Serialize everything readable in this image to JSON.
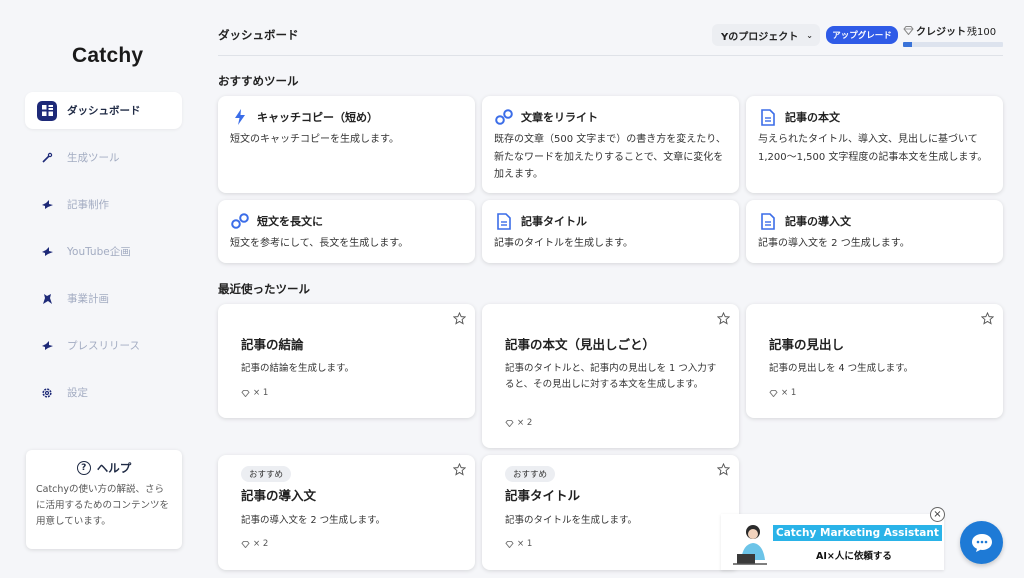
{
  "app": {
    "logo": "Catchy"
  },
  "sidebar": {
    "items": [
      {
        "label": "ダッシュボード",
        "icon": "dashboard-icon",
        "active": true
      },
      {
        "label": "生成ツール",
        "icon": "magic-wand-icon"
      },
      {
        "label": "記事制作",
        "icon": "bird-icon"
      },
      {
        "label": "YouTube企画",
        "icon": "bird-icon"
      },
      {
        "label": "事業計画",
        "icon": "unicorn-icon"
      },
      {
        "label": "プレスリリース",
        "icon": "bird-icon"
      },
      {
        "label": "設定",
        "icon": "gear-icon"
      }
    ],
    "help": {
      "title": "ヘルプ",
      "text": "Catchyの使い方の解説、さらに活用するためのコンテンツを用意しています。"
    }
  },
  "header": {
    "title": "ダッシュボード",
    "project": "Yのプロジェクト",
    "upgrade": "アップグレード",
    "credit_label": "クレジット",
    "credit_rest": "残100",
    "credit_fraction": 0.09,
    "accent": "#2f5be7"
  },
  "recommended": {
    "title": "おすすめツール",
    "cards": [
      {
        "title": "キャッチコピー（短め）",
        "desc": "短文のキャッチコピーを生成します。",
        "icon": "lightning-icon"
      },
      {
        "title": "文章をリライト",
        "desc": "既存の文章（500 文字まで）の書き方を変えたり、新たなワードを加えたりすることで、文章に変化を加えます。",
        "icon": "bubbles-icon"
      },
      {
        "title": "記事の本文",
        "desc": "与えられたタイトル、導入文、見出しに基づいて 1,200〜1,500 文字程度の記事本文を生成します。",
        "icon": "document-icon"
      },
      {
        "title": "短文を長文に",
        "desc": "短文を参考にして、長文を生成します。",
        "icon": "bubbles-icon"
      },
      {
        "title": "記事タイトル",
        "desc": "記事のタイトルを生成します。",
        "icon": "document-icon"
      },
      {
        "title": "記事の導入文",
        "desc": "記事の導入文を 2 つ生成します。",
        "icon": "document-icon"
      }
    ]
  },
  "recent": {
    "title": "最近使ったツール",
    "cards": [
      {
        "title": "記事の結論",
        "desc": "記事の結論を生成します。",
        "cost": "× 1"
      },
      {
        "title": "記事の本文（見出しごと）",
        "desc": "記事のタイトルと、記事内の見出しを 1 つ入力すると、その見出しに対する本文を生成します。",
        "cost": "× 2"
      },
      {
        "title": "記事の見出し",
        "desc": "記事の見出しを 4 つ生成します。",
        "cost": "× 1"
      },
      {
        "badge": "おすすめ",
        "title": "記事の導入文",
        "desc": "記事の導入文を 2 つ生成します。",
        "cost": "× 2"
      },
      {
        "badge": "おすすめ",
        "title": "記事タイトル",
        "desc": "記事のタイトルを生成します。",
        "cost": "× 1"
      }
    ]
  },
  "assistant": {
    "name": "Catchy Marketing Assistant",
    "sub": "AI×人に依頼する",
    "close": "×"
  }
}
